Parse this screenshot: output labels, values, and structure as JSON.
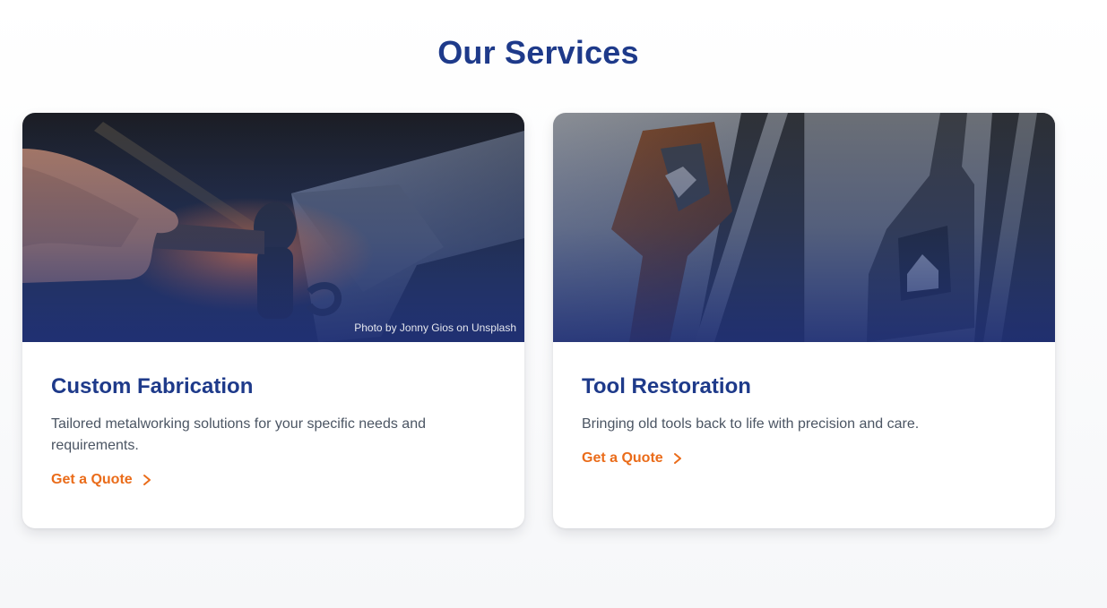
{
  "section": {
    "title": "Our Services"
  },
  "cards": [
    {
      "title": "Custom Fabrication",
      "description": "Tailored metalworking solutions for your specific needs and requirements.",
      "link_label": "Get a Quote",
      "photo_credit": "Photo by Jonny Gios on Unsplash",
      "image_name": "blacksmith-hammer-anvil-photo"
    },
    {
      "title": "Tool Restoration",
      "description": "Bringing old tools back to life with precision and care.",
      "link_label": "Get a Quote",
      "image_name": "tap-wrench-before-after-photo"
    }
  ],
  "colors": {
    "heading": "#1e3a8a",
    "accent": "#ea6c1a",
    "body_text": "#4b5563"
  },
  "icons": {
    "link_arrow": "chevron-right-icon"
  }
}
